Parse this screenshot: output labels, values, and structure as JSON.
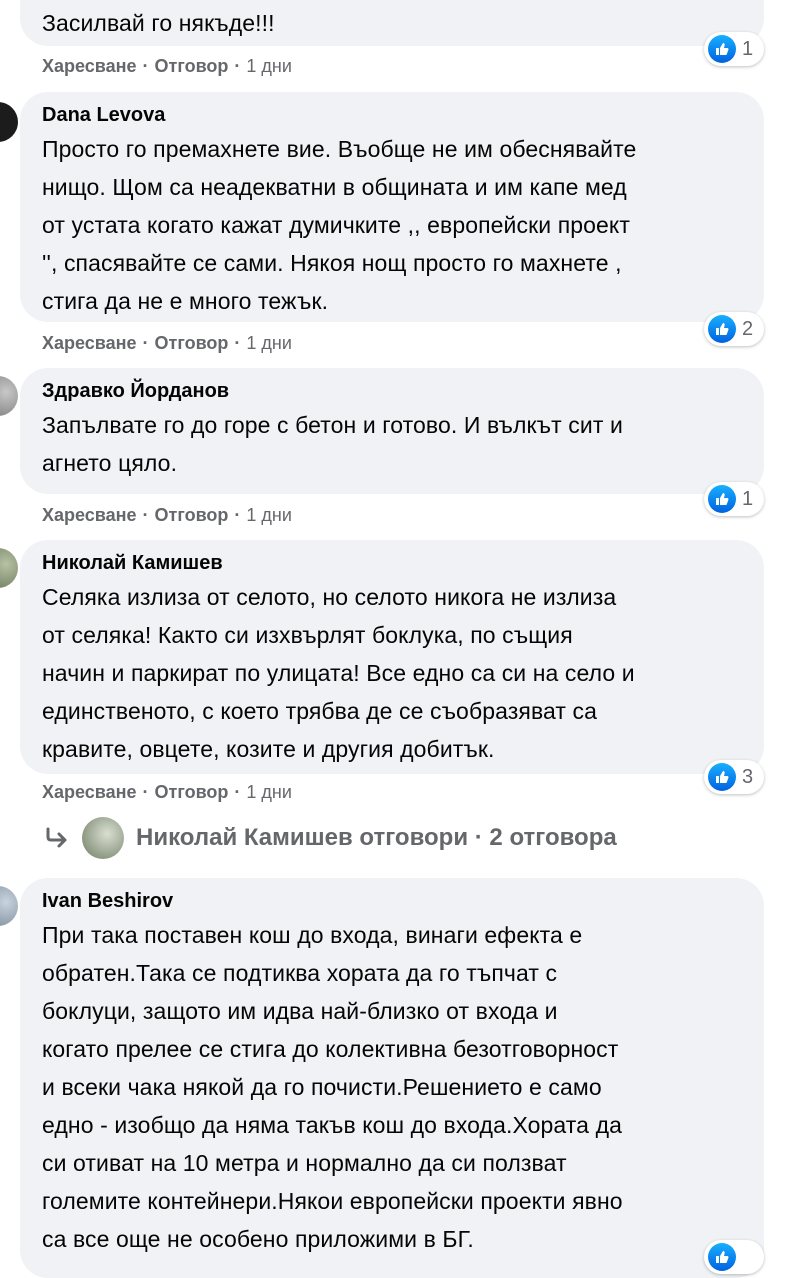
{
  "comments": [
    {
      "name": "",
      "text": "Засилвай го някъде!!!",
      "reactions": "1",
      "like_label": "Харесване",
      "reply_label": "Отговор",
      "time": "1 дни"
    },
    {
      "name": "Dana Levova",
      "text": "Просто го премахнете вие. Въобще не им обеснявайте\nнищо. Щом са неадекватни в общината и им капе мед\nот устата когато кажат думичките ,, европейски проект\n'', спасявайте се сами. Някоя нощ просто го махнете ,\nстига да не е много тежък.",
      "reactions": "2",
      "like_label": "Харесване",
      "reply_label": "Отговор",
      "time": "1 дни"
    },
    {
      "name": "Здравко Йорданов",
      "text": "Запълвате го до горе с бетон и готово. И вълкът сит и\nагнето цяло.",
      "reactions": "1",
      "like_label": "Харесване",
      "reply_label": "Отговор",
      "time": "1 дни"
    },
    {
      "name": "Николай Камишев",
      "text": "Селяка излиза от селото, но селото никога не излиза\nот селяка! Както си изхвърлят боклука, по същия\nначин и паркират по улицата! Все едно са си на село и\nединственото, с което трябва де се съобразяват са\nкравите, овцете, козите и другия добитък.",
      "reactions": "3",
      "like_label": "Харесване",
      "reply_label": "Отговор",
      "time": "1 дни"
    },
    {
      "name": "Ivan Beshirov",
      "text": "При така поставен кош до входа, винаги ефекта е\nобратен.Така се подтиква хората да го тъпчат с\nбоклуци, защото им идва най-близко от входа и\nкогато прелее се стига до колективна безотговорност\nи всеки чака някой да го почисти.Решението е само\nедно - изобщо да няма такъв кош до входа.Хората да\nси отиват на 10 метра и нормално да си ползват\nголемите контейнери.Някои европейски проекти явно\nса все още не особено приложими в БГ."
    }
  ],
  "replies_thread": {
    "text": "Николай Камишев отговори · 2 отговора"
  },
  "icons": {
    "like": "like-icon",
    "reply_arrow": "reply-arrow-icon"
  },
  "colors": {
    "bubble": "#f0f2f5",
    "secondary_text": "#65676b",
    "like_blue": "#1877f2"
  }
}
